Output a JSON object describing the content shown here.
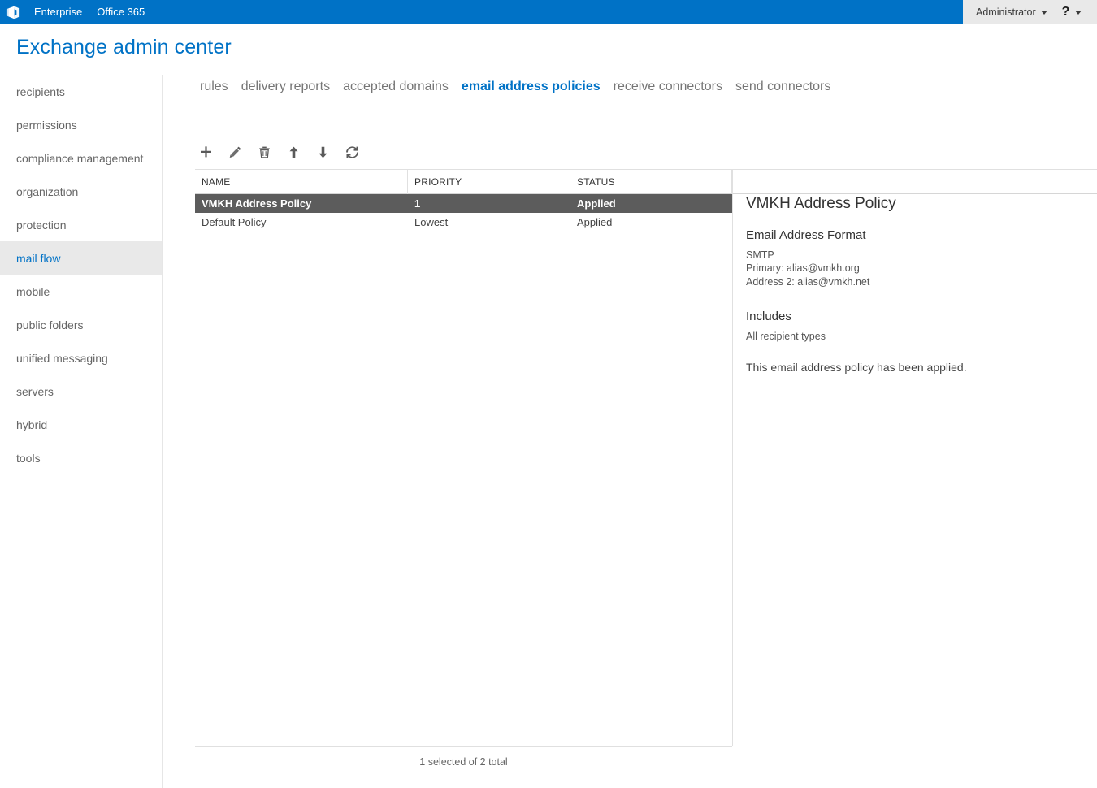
{
  "suite_bar": {
    "logo_icon": "office-logo-icon",
    "links": [
      {
        "label": "Enterprise"
      },
      {
        "label": "Office 365"
      }
    ],
    "account": {
      "label": "Administrator",
      "caret_icon": "chevron-down-icon"
    },
    "help": {
      "glyph": "?",
      "caret_icon": "chevron-down-icon"
    }
  },
  "header": {
    "title": "Exchange admin center",
    "accent_color": "#0072c6"
  },
  "sidebar": {
    "selected": "mail flow",
    "items": [
      {
        "label": "recipients"
      },
      {
        "label": "permissions"
      },
      {
        "label": "compliance management"
      },
      {
        "label": "organization"
      },
      {
        "label": "protection"
      },
      {
        "label": "mail flow"
      },
      {
        "label": "mobile"
      },
      {
        "label": "public folders"
      },
      {
        "label": "unified messaging"
      },
      {
        "label": "servers"
      },
      {
        "label": "hybrid"
      },
      {
        "label": "tools"
      }
    ]
  },
  "tabs": {
    "active": "email address policies",
    "items": [
      {
        "label": "rules"
      },
      {
        "label": "delivery reports"
      },
      {
        "label": "accepted domains"
      },
      {
        "label": "email address policies"
      },
      {
        "label": "receive connectors"
      },
      {
        "label": "send connectors"
      }
    ]
  },
  "toolbar": {
    "buttons": [
      {
        "name": "add-button",
        "icon": "plus-icon",
        "title": "New"
      },
      {
        "name": "edit-button",
        "icon": "pencil-icon",
        "title": "Edit"
      },
      {
        "name": "delete-button",
        "icon": "trash-icon",
        "title": "Delete"
      },
      {
        "name": "move-up-button",
        "icon": "arrow-up-icon",
        "title": "Move up"
      },
      {
        "name": "move-down-button",
        "icon": "arrow-down-icon",
        "title": "Move down"
      },
      {
        "name": "refresh-button",
        "icon": "refresh-icon",
        "title": "Refresh"
      }
    ]
  },
  "table": {
    "columns": [
      "NAME",
      "PRIORITY",
      "STATUS",
      ""
    ],
    "rows": [
      {
        "name": "VMKH Address Policy",
        "priority": "1",
        "status": "Applied",
        "selected": true
      },
      {
        "name": "Default Policy",
        "priority": "Lowest",
        "status": "Applied",
        "selected": false
      }
    ],
    "status_text": "1 selected of 2 total",
    "selected_row_color": "#5c5c5c"
  },
  "details": {
    "title": "VMKH Address Policy",
    "format_heading": "Email Address Format",
    "format_lines": [
      "SMTP",
      "Primary: alias@vmkh.org",
      "Address 2: alias@vmkh.net"
    ],
    "includes_heading": "Includes",
    "includes_value": "All recipient types",
    "note": "This email address policy has been applied."
  }
}
